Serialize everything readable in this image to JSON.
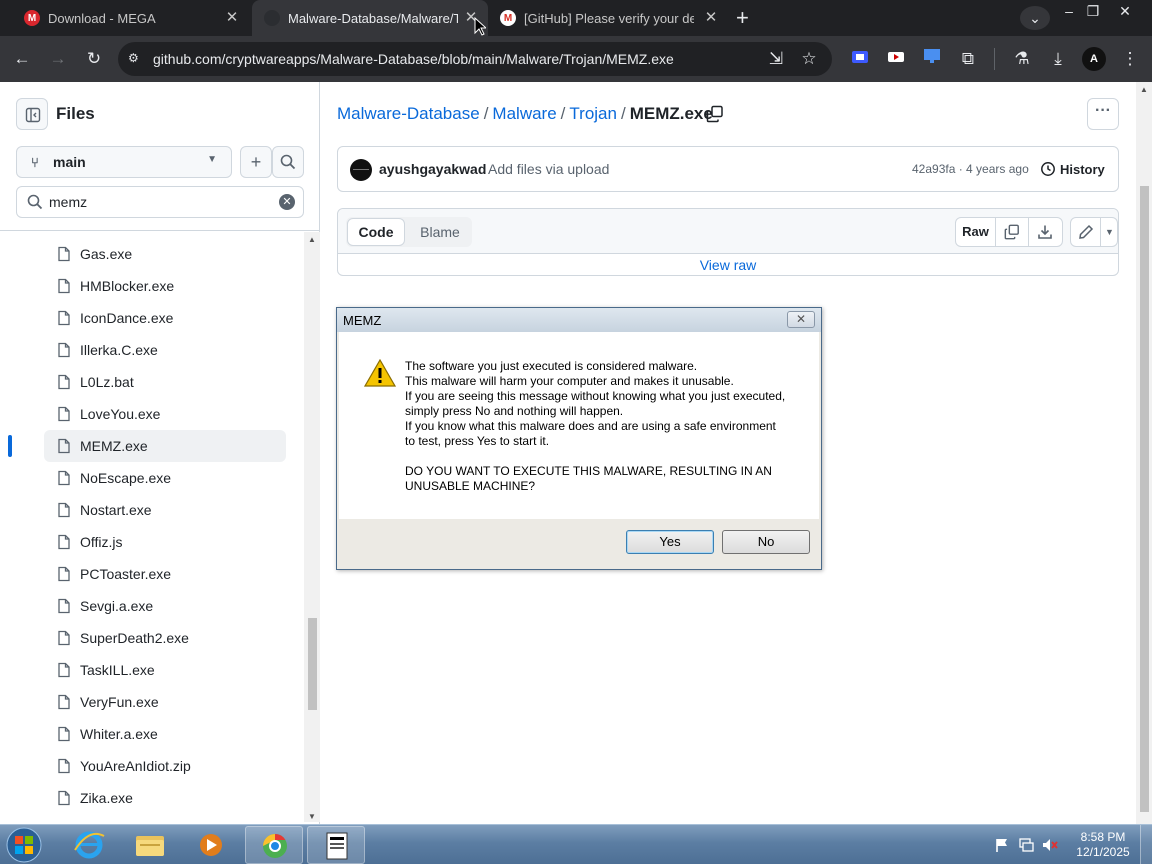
{
  "browser": {
    "tabs": [
      {
        "title": "Download - MEGA",
        "icon": "mega-icon",
        "color": "#d9272e"
      },
      {
        "title": "Malware-Database/Malware/Tro",
        "icon": "github-icon",
        "active": true
      },
      {
        "title": "[GitHub] Please verify your devi",
        "icon": "gmail-icon"
      }
    ],
    "new_tab": "+",
    "url": "github.com/cryptwareapps/Malware-Database/blob/main/Malware/Trojan/MEMZ.exe"
  },
  "sidebar": {
    "title": "Files",
    "branch": "main",
    "filter_value": "memz",
    "files": [
      {
        "name": "Gas.exe"
      },
      {
        "name": "HMBlocker.exe"
      },
      {
        "name": "IconDance.exe"
      },
      {
        "name": "Illerka.C.exe"
      },
      {
        "name": "L0Lz.bat"
      },
      {
        "name": "LoveYou.exe"
      },
      {
        "name": "MEMZ.exe",
        "active": true
      },
      {
        "name": "NoEscape.exe"
      },
      {
        "name": "Nostart.exe"
      },
      {
        "name": "Offiz.js"
      },
      {
        "name": "PCToaster.exe"
      },
      {
        "name": "Sevgi.a.exe"
      },
      {
        "name": "SuperDeath2.exe"
      },
      {
        "name": "TaskILL.exe"
      },
      {
        "name": "VeryFun.exe"
      },
      {
        "name": "Whiter.a.exe"
      },
      {
        "name": "YouAreAnIdiot.zip"
      },
      {
        "name": "Zika.exe"
      }
    ]
  },
  "breadcrumb": {
    "repo": "Malware-Database",
    "folder1": "Malware",
    "folder2": "Trojan",
    "file": "MEMZ.exe",
    "sep": "/"
  },
  "commit": {
    "author": "ayushgayakwad",
    "message": "Add files via upload",
    "meta": "42a93fa · 4 years ago",
    "history": "History"
  },
  "file_view": {
    "code_tab": "Code",
    "blame_tab": "Blame",
    "raw_button": "Raw",
    "view_raw": "View raw"
  },
  "dialog": {
    "title": "MEMZ",
    "lines": [
      "The software you just executed is considered malware.",
      "This malware will harm your computer and makes it unusable.",
      "If you are seeing this message without knowing what you just executed,",
      "simply press No and nothing will happen.",
      "If you know what this malware does and are using a safe environment",
      "to test, press Yes to start it.",
      "DO YOU WANT TO EXECUTE THIS MALWARE, RESULTING IN AN",
      "UNUSABLE MACHINE?"
    ],
    "yes": "Yes",
    "no": "No"
  },
  "taskbar": {
    "time": "8:58 PM",
    "date": "12/1/2025"
  },
  "colors": {
    "link": "#0969da",
    "chrome_dark": "#202124",
    "taskbar": "#5c7ea3"
  }
}
